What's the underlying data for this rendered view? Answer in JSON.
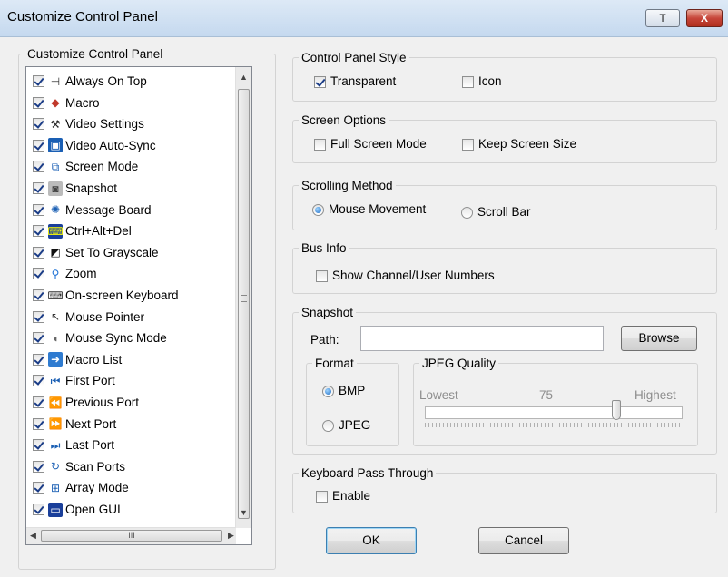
{
  "window": {
    "title": "Customize Control Panel",
    "help_label": "T",
    "close_label": "X"
  },
  "list_panel": {
    "legend": "Customize Control Panel",
    "items": [
      {
        "label": "Always On Top",
        "checked": true,
        "icon": "pin-icon"
      },
      {
        "label": "Macro",
        "checked": true,
        "icon": "macro-icon"
      },
      {
        "label": "Video Settings",
        "checked": true,
        "icon": "hammer-icon"
      },
      {
        "label": "Video Auto-Sync",
        "checked": true,
        "icon": "monitor-sync-icon"
      },
      {
        "label": "Screen Mode",
        "checked": true,
        "icon": "screen-mode-icon"
      },
      {
        "label": "Snapshot",
        "checked": true,
        "icon": "camera-icon"
      },
      {
        "label": "Message Board",
        "checked": true,
        "icon": "message-board-icon"
      },
      {
        "label": "Ctrl+Alt+Del",
        "checked": true,
        "icon": "ctrl-alt-del-icon"
      },
      {
        "label": "Set To Grayscale",
        "checked": true,
        "icon": "grayscale-icon"
      },
      {
        "label": "Zoom",
        "checked": true,
        "icon": "magnifier-icon"
      },
      {
        "label": "On-screen Keyboard",
        "checked": true,
        "icon": "keyboard-icon"
      },
      {
        "label": "Mouse Pointer",
        "checked": true,
        "icon": "pointer-icon"
      },
      {
        "label": "Mouse Sync Mode",
        "checked": true,
        "icon": "mouse-icon"
      },
      {
        "label": "Macro List",
        "checked": true,
        "icon": "macro-list-icon"
      },
      {
        "label": "First Port",
        "checked": true,
        "icon": "first-port-icon"
      },
      {
        "label": "Previous Port",
        "checked": true,
        "icon": "previous-port-icon"
      },
      {
        "label": "Next Port",
        "checked": true,
        "icon": "next-port-icon"
      },
      {
        "label": "Last Port",
        "checked": true,
        "icon": "last-port-icon"
      },
      {
        "label": "Scan Ports",
        "checked": true,
        "icon": "scan-ports-icon"
      },
      {
        "label": "Array Mode",
        "checked": true,
        "icon": "array-mode-icon"
      },
      {
        "label": "Open GUI",
        "checked": true,
        "icon": "gui-icon"
      }
    ],
    "hscroll_thumb_label": "III"
  },
  "control_panel_style": {
    "legend": "Control Panel Style",
    "transparent_label": "Transparent",
    "transparent_checked": true,
    "icon_label": "Icon",
    "icon_checked": false
  },
  "screen_options": {
    "legend": "Screen Options",
    "full_screen_label": "Full Screen Mode",
    "full_screen_checked": false,
    "keep_size_label": "Keep Screen Size",
    "keep_size_checked": false
  },
  "scrolling_method": {
    "legend": "Scrolling Method",
    "mouse_movement_label": "Mouse Movement",
    "scroll_bar_label": "Scroll Bar",
    "selected": "Mouse Movement"
  },
  "bus_info": {
    "legend": "Bus Info",
    "show_numbers_label": "Show Channel/User Numbers",
    "show_numbers_checked": false
  },
  "snapshot": {
    "legend": "Snapshot",
    "path_label": "Path:",
    "path_value": "",
    "browse_label": "Browse",
    "format_legend": "Format",
    "bmp_label": "BMP",
    "jpeg_label": "JPEG",
    "selected_format": "BMP",
    "quality_legend": "JPEG Quality",
    "lowest_label": "Lowest",
    "quality_value": "75",
    "highest_label": "Highest",
    "quality_level": 75
  },
  "keyboard_pass": {
    "legend": "Keyboard Pass Through",
    "enable_label": "Enable",
    "enable_checked": false
  },
  "buttons": {
    "ok_label": "OK",
    "cancel_label": "Cancel"
  }
}
